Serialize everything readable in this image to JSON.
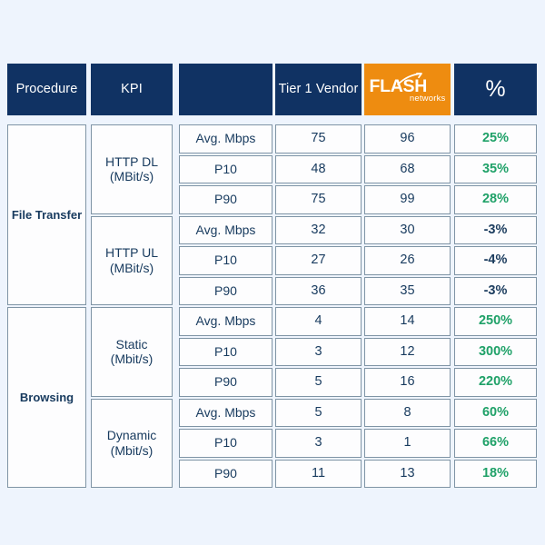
{
  "table": {
    "headers": [
      {
        "label": "Procedure",
        "type": "text"
      },
      {
        "label": "KPI",
        "type": "text"
      },
      {
        "label": "",
        "type": "blank"
      },
      {
        "label": "Tier 1 Vendor",
        "type": "text"
      },
      {
        "label": "FLASH",
        "sub": "networks",
        "type": "logo"
      },
      {
        "label": "%",
        "type": "percent"
      }
    ],
    "procedures": [
      {
        "label": "File Transfer",
        "rows": 6
      },
      {
        "label": "Browsing",
        "rows": 6
      }
    ],
    "kpi_groups": [
      {
        "name": "HTTP DL",
        "unit": "(MBit/s)",
        "rows": 3
      },
      {
        "name": "HTTP UL",
        "unit": "(MBit/s)",
        "rows": 3
      },
      {
        "name": "Static",
        "unit": "(Mbit/s)",
        "rows": 3
      },
      {
        "name": "Dynamic",
        "unit": "(Mbit/s)",
        "rows": 3
      }
    ],
    "rows": [
      {
        "metric": "Avg. Mbps",
        "tier1": "75",
        "flash": "96",
        "pct": "25%",
        "sign": "pos"
      },
      {
        "metric": "P10",
        "tier1": "48",
        "flash": "68",
        "pct": "35%",
        "sign": "pos"
      },
      {
        "metric": "P90",
        "tier1": "75",
        "flash": "99",
        "pct": "28%",
        "sign": "pos"
      },
      {
        "metric": "Avg. Mbps",
        "tier1": "32",
        "flash": "30",
        "pct": "-3%",
        "sign": "neg"
      },
      {
        "metric": "P10",
        "tier1": "27",
        "flash": "26",
        "pct": "-4%",
        "sign": "neg"
      },
      {
        "metric": "P90",
        "tier1": "36",
        "flash": "35",
        "pct": "-3%",
        "sign": "neg"
      },
      {
        "metric": "Avg. Mbps",
        "tier1": "4",
        "flash": "14",
        "pct": "250%",
        "sign": "pos"
      },
      {
        "metric": "P10",
        "tier1": "3",
        "flash": "12",
        "pct": "300%",
        "sign": "pos"
      },
      {
        "metric": "P90",
        "tier1": "5",
        "flash": "16",
        "pct": "220%",
        "sign": "pos"
      },
      {
        "metric": "Avg. Mbps",
        "tier1": "5",
        "flash": "8",
        "pct": "60%",
        "sign": "pos"
      },
      {
        "metric": "P10",
        "tier1": "3",
        "flash": "1",
        "pct": "66%",
        "sign": "pos"
      },
      {
        "metric": "P90",
        "tier1": "11",
        "flash": "13",
        "pct": "18%",
        "sign": "pos"
      }
    ]
  },
  "colors": {
    "header_blue": "#103263",
    "logo_orange": "#ee8c10",
    "positive_green": "#1fa168",
    "text_navy": "#173a5e",
    "page_background": "#eef4fd",
    "cell_border": "#7f94a5"
  }
}
